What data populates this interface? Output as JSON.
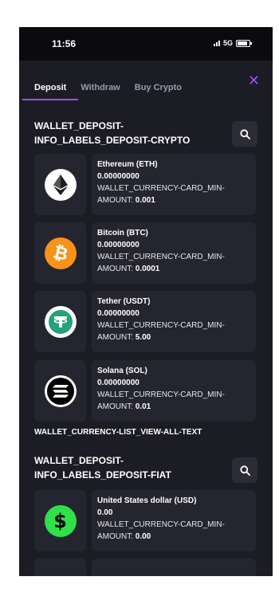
{
  "status": {
    "time": "11:56",
    "network": "5G"
  },
  "tabs": [
    {
      "label": "Deposit"
    },
    {
      "label": "Withdraw"
    },
    {
      "label": "Buy Crypto"
    }
  ],
  "close_label": "✕",
  "crypto_section": {
    "title": "WALLET_DEPOSIT-INFO_LABELS_DEPOSIT-CRYPTO"
  },
  "crypto_cards": [
    {
      "name": "Ethereum (ETH)",
      "balance": "0.00000000",
      "min_label": "WALLET_CURRENCY-CARD_MIN-AMOUNT:",
      "min_value": "0.001",
      "icon": "ethereum-icon"
    },
    {
      "name": "Bitcoin (BTC)",
      "balance": "0.00000000",
      "min_label": "WALLET_CURRENCY-CARD_MIN-AMOUNT:",
      "min_value": "0.0001",
      "icon": "bitcoin-icon"
    },
    {
      "name": "Tether (USDT)",
      "balance": "0.00000000",
      "min_label": "WALLET_CURRENCY-CARD_MIN-AMOUNT:",
      "min_value": "5.00",
      "icon": "tether-icon"
    },
    {
      "name": "Solana (SOL)",
      "balance": "0.00000000",
      "min_label": "WALLET_CURRENCY-CARD_MIN-AMOUNT:",
      "min_value": "0.01",
      "icon": "solana-icon"
    }
  ],
  "view_all": "WALLET_CURRENCY-LIST_VIEW-ALL-TEXT",
  "fiat_section": {
    "title": "WALLET_DEPOSIT-INFO_LABELS_DEPOSIT-FIAT"
  },
  "fiat_cards": [
    {
      "name": "United States dollar (USD)",
      "balance": "0.00",
      "min_label": "WALLET_CURRENCY-CARD_MIN-AMOUNT:",
      "min_value": "0.00",
      "icon": "dollar-icon"
    }
  ],
  "colors": {
    "accent": "#a24ff5",
    "background": "#1c1c24",
    "card": "#25252f",
    "bitcoin": "#f7931a",
    "tether": "#26a17b",
    "usd": "#2ee04a"
  }
}
